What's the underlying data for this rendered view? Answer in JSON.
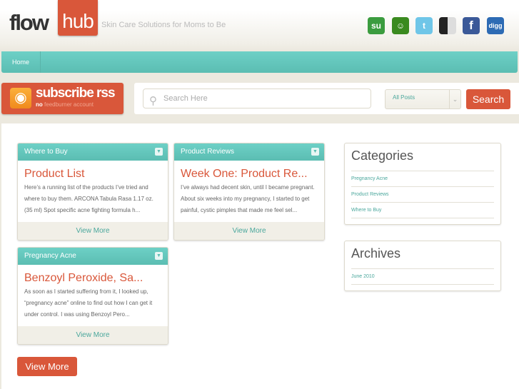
{
  "header": {
    "logo_left": "flow",
    "logo_right": "hub",
    "tagline": "Skin Care Solutions for Moms to Be",
    "social": [
      {
        "name": "stumbleupon",
        "label": "su",
        "color": "#3b9c3f"
      },
      {
        "name": "friendfeed",
        "label": "☺",
        "color": "#3a8a1f"
      },
      {
        "name": "twitter",
        "label": "t",
        "color": "#6fc6e8"
      },
      {
        "name": "delicious",
        "label": "",
        "color": "#222222"
      },
      {
        "name": "facebook",
        "label": "f",
        "color": "#3b5998"
      },
      {
        "name": "digg",
        "label": "digg",
        "color": "#2d6bb4"
      }
    ]
  },
  "nav": {
    "items": [
      {
        "label": "Home"
      }
    ]
  },
  "rss": {
    "title": "subscribe rss",
    "sub_bold": "no",
    "sub_text": "feedburner account"
  },
  "search": {
    "placeholder": "Search Here",
    "select_value": "All Posts",
    "button": "Search"
  },
  "cards": [
    {
      "category": "Where to Buy",
      "title": "Product List",
      "text": "Here’s a running list of the products I’ve tried and where to buy them. ARCONA Tabula Rasa 1.17 oz. (35 ml) Spot specific acne fighting formula h...",
      "more": "View More"
    },
    {
      "category": "Product Reviews",
      "title": "Week One: Product Re...",
      "text": "I’ve always had decent skin, until I became pregnant. About six weeks into my pregnancy, I started to get painful, cystic pimples that made me feel sel...",
      "more": "View More"
    },
    {
      "category": "Pregnancy Acne",
      "title": "Benzoyl Peroxide, Sa...",
      "text": "As soon as I started suffering from it, I looked up, “pregnancy acne” online to find out how I can get it under control. I was using Benzoyl Pero...",
      "more": "View More"
    }
  ],
  "view_more": "View More",
  "sidebar": {
    "categories": {
      "title": "Categories",
      "items": [
        "Pregnancy Acne",
        "Product Reviews",
        "Where to Buy"
      ]
    },
    "archives": {
      "title": "Archives",
      "items": [
        "June 2010"
      ]
    }
  }
}
